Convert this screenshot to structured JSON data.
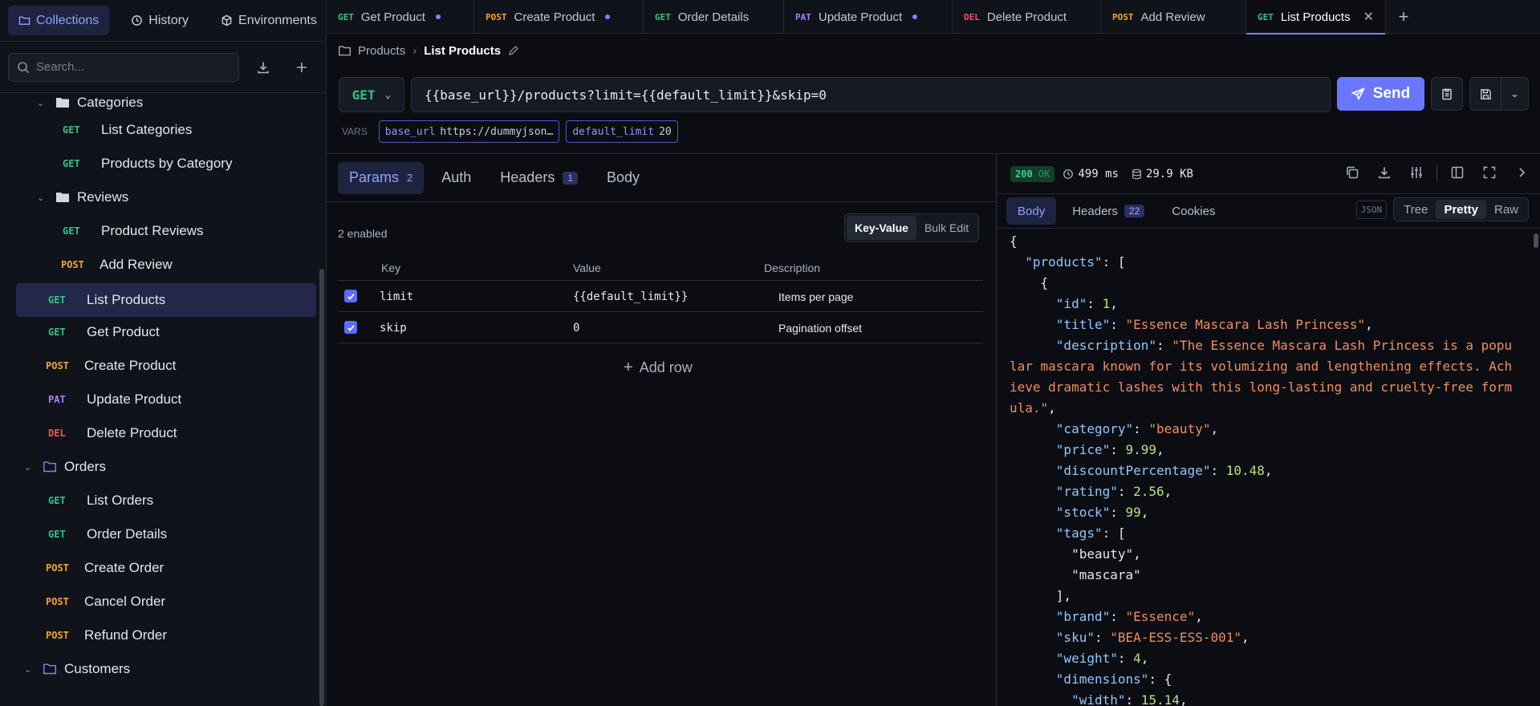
{
  "sidebar": {
    "tabs": [
      {
        "label": "Collections",
        "icon": "folder-icon"
      },
      {
        "label": "History",
        "icon": "clock-icon"
      },
      {
        "label": "Environments",
        "icon": "cube-icon"
      }
    ],
    "search_placeholder": "Search...",
    "tree": {
      "categories_folder": "Categories",
      "list_categories": {
        "method": "GET",
        "label": "List Categories"
      },
      "products_by_category": {
        "method": "GET",
        "label": "Products by Category"
      },
      "reviews_folder": "Reviews",
      "product_reviews": {
        "method": "GET",
        "label": "Product Reviews"
      },
      "add_review": {
        "method": "POST",
        "label": "Add Review"
      },
      "list_products": {
        "method": "GET",
        "label": "List Products"
      },
      "get_product": {
        "method": "GET",
        "label": "Get Product"
      },
      "create_product": {
        "method": "POST",
        "label": "Create Product"
      },
      "update_product": {
        "method": "PAT",
        "label": "Update Product"
      },
      "delete_product": {
        "method": "DEL",
        "label": "Delete Product"
      },
      "orders_folder": "Orders",
      "list_orders": {
        "method": "GET",
        "label": "List Orders"
      },
      "order_details": {
        "method": "GET",
        "label": "Order Details"
      },
      "create_order": {
        "method": "POST",
        "label": "Create Order"
      },
      "cancel_order": {
        "method": "POST",
        "label": "Cancel Order"
      },
      "refund_order": {
        "method": "POST",
        "label": "Refund Order"
      },
      "customers_folder": "Customers"
    }
  },
  "tabs": [
    {
      "method": "GET",
      "label": "Get Product"
    },
    {
      "method": "POST",
      "label": "Create Product"
    },
    {
      "method": "GET",
      "label": "Order Details"
    },
    {
      "method": "PAT",
      "label": "Update Product"
    },
    {
      "method": "DEL",
      "label": "Delete Product"
    },
    {
      "method": "POST",
      "label": "Add Review"
    },
    {
      "method": "GET",
      "label": "List Products"
    }
  ],
  "breadcrumb": {
    "parent": "Products",
    "current": "List Products"
  },
  "request": {
    "method": "GET",
    "url": "{{base_url}}/products?limit={{default_limit}}&skip=0",
    "send_label": "Send",
    "vars_label": "VARS",
    "vars": [
      {
        "key": "base_url",
        "value": "https://dummyjson…"
      },
      {
        "key": "default_limit",
        "value": "20"
      }
    ],
    "tabs": {
      "params": "Params",
      "params_count": "2",
      "auth": "Auth",
      "headers": "Headers",
      "headers_count": "1",
      "body": "Body"
    },
    "enabled_text": "2 enabled",
    "mode": {
      "kv": "Key-Value",
      "bulk": "Bulk Edit"
    },
    "columns": {
      "key": "Key",
      "value": "Value",
      "description": "Description"
    },
    "params": [
      {
        "key": "limit",
        "value": "{{default_limit}}",
        "description": "Items per page"
      },
      {
        "key": "skip",
        "value": "0",
        "description": "Pagination offset"
      }
    ],
    "add_row": "Add row"
  },
  "response": {
    "status_code": "200",
    "status_text": "OK",
    "time": "499 ms",
    "size": "29.9 KB",
    "tabs": {
      "body": "Body",
      "headers": "Headers",
      "headers_count": "22",
      "cookies": "Cookies"
    },
    "format_badge": "JSON",
    "views": {
      "tree": "Tree",
      "pretty": "Pretty",
      "raw": "Raw"
    }
  },
  "json_lines": [
    {
      "t": [
        [
          "p",
          "{"
        ]
      ]
    },
    {
      "t": [
        [
          "p",
          "  "
        ],
        [
          "k",
          "\"products\""
        ],
        [
          "p",
          ": ["
        ]
      ]
    },
    {
      "t": [
        [
          "p",
          "    {"
        ]
      ]
    },
    {
      "t": [
        [
          "p",
          "      "
        ],
        [
          "k",
          "\"id\""
        ],
        [
          "p",
          ": "
        ],
        [
          "n",
          "1"
        ],
        [
          "p",
          ","
        ]
      ]
    },
    {
      "t": [
        [
          "p",
          "      "
        ],
        [
          "k",
          "\"title\""
        ],
        [
          "p",
          ": "
        ],
        [
          "s",
          "\"Essence Mascara Lash Princess\""
        ],
        [
          "p",
          ","
        ]
      ]
    },
    {
      "t": [
        [
          "p",
          "      "
        ],
        [
          "k",
          "\"description\""
        ],
        [
          "p",
          ": "
        ],
        [
          "s",
          "\"The Essence Mascara Lash Princess is a popu"
        ]
      ]
    },
    {
      "t": [
        [
          "s",
          "lar mascara known for its volumizing and lengthening effects. Ach"
        ]
      ]
    },
    {
      "t": [
        [
          "s",
          "ieve dramatic lashes with this long-lasting and cruelty-free form"
        ]
      ]
    },
    {
      "t": [
        [
          "s",
          "ula.\""
        ],
        [
          "p",
          ","
        ]
      ]
    },
    {
      "t": [
        [
          "p",
          "      "
        ],
        [
          "k",
          "\"category\""
        ],
        [
          "p",
          ": "
        ],
        [
          "s",
          "\"beauty\""
        ],
        [
          "p",
          ","
        ]
      ]
    },
    {
      "t": [
        [
          "p",
          "      "
        ],
        [
          "k",
          "\"price\""
        ],
        [
          "p",
          ": "
        ],
        [
          "n",
          "9.99"
        ],
        [
          "p",
          ","
        ]
      ]
    },
    {
      "t": [
        [
          "p",
          "      "
        ],
        [
          "k",
          "\"discountPercentage\""
        ],
        [
          "p",
          ": "
        ],
        [
          "n",
          "10.48"
        ],
        [
          "p",
          ","
        ]
      ]
    },
    {
      "t": [
        [
          "p",
          "      "
        ],
        [
          "k",
          "\"rating\""
        ],
        [
          "p",
          ": "
        ],
        [
          "n",
          "2.56"
        ],
        [
          "p",
          ","
        ]
      ]
    },
    {
      "t": [
        [
          "p",
          "      "
        ],
        [
          "k",
          "\"stock\""
        ],
        [
          "p",
          ": "
        ],
        [
          "n",
          "99"
        ],
        [
          "p",
          ","
        ]
      ]
    },
    {
      "t": [
        [
          "p",
          "      "
        ],
        [
          "k",
          "\"tags\""
        ],
        [
          "p",
          ": ["
        ]
      ]
    },
    {
      "t": [
        [
          "p",
          "        \"beauty\","
        ]
      ]
    },
    {
      "t": [
        [
          "p",
          "        \"mascara\""
        ]
      ]
    },
    {
      "t": [
        [
          "p",
          "      ],"
        ]
      ]
    },
    {
      "t": [
        [
          "p",
          "      "
        ],
        [
          "k",
          "\"brand\""
        ],
        [
          "p",
          ": "
        ],
        [
          "s",
          "\"Essence\""
        ],
        [
          "p",
          ","
        ]
      ]
    },
    {
      "t": [
        [
          "p",
          "      "
        ],
        [
          "k",
          "\"sku\""
        ],
        [
          "p",
          ": "
        ],
        [
          "s",
          "\"BEA-ESS-ESS-001\""
        ],
        [
          "p",
          ","
        ]
      ]
    },
    {
      "t": [
        [
          "p",
          "      "
        ],
        [
          "k",
          "\"weight\""
        ],
        [
          "p",
          ": "
        ],
        [
          "n",
          "4"
        ],
        [
          "p",
          ","
        ]
      ]
    },
    {
      "t": [
        [
          "p",
          "      "
        ],
        [
          "k",
          "\"dimensions\""
        ],
        [
          "p",
          ": {"
        ]
      ]
    },
    {
      "t": [
        [
          "p",
          "        "
        ],
        [
          "k",
          "\"width\""
        ],
        [
          "p",
          ": "
        ],
        [
          "n",
          "15.14"
        ],
        [
          "p",
          ","
        ]
      ]
    }
  ],
  "colors": {
    "accent": "#6b76ff",
    "get": "#2fc486",
    "post": "#f5a524",
    "patch": "#a881ff",
    "delete": "#f2555a"
  }
}
